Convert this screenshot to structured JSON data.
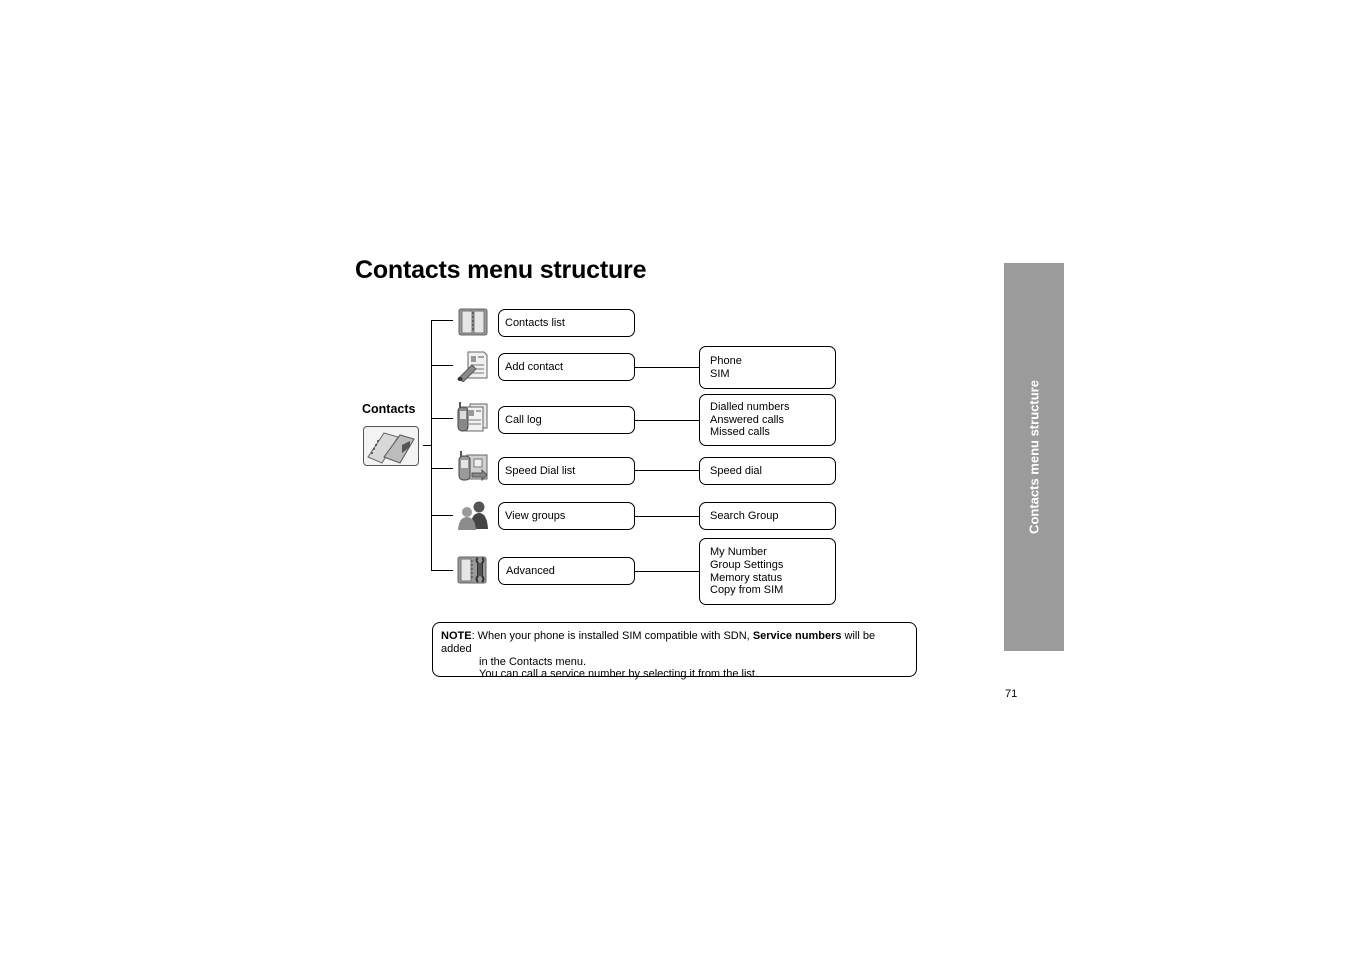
{
  "page": {
    "title": "Contacts menu structure",
    "side_tab_label": "Contacts menu structure",
    "page_number": "71",
    "side_tab_color": "#9b9b9b"
  },
  "tree": {
    "root": {
      "label": "Contacts",
      "icon": "contacts-book-icon"
    },
    "items": [
      {
        "label": "Contacts list",
        "icon": "address-book-icon",
        "children": []
      },
      {
        "label": "Add contact",
        "icon": "add-contact-pen-icon",
        "children": [
          "Phone",
          "SIM"
        ]
      },
      {
        "label": "Call log",
        "icon": "call-log-phone-icon",
        "children": [
          "Dialled numbers",
          "Answered calls",
          "Missed calls"
        ]
      },
      {
        "label": "Speed Dial list",
        "icon": "speed-dial-phone-icon",
        "children": [
          "Speed dial"
        ]
      },
      {
        "label": "View groups",
        "icon": "people-group-icon",
        "children": [
          "Search Group"
        ]
      },
      {
        "label": "Advanced",
        "icon": "book-wrench-icon",
        "children": [
          "My Number",
          "Group Settings",
          "Memory status",
          "Copy from SIM"
        ]
      }
    ]
  },
  "note": {
    "prefix": "NOTE",
    "text_before_bold": ": When your phone is installed SIM compatible with SDN, ",
    "bold": "Service numbers",
    "text_after_bold": " will be added",
    "line2": "in the Contacts menu.",
    "line3": "You can call a service number by selecting it from the list."
  }
}
